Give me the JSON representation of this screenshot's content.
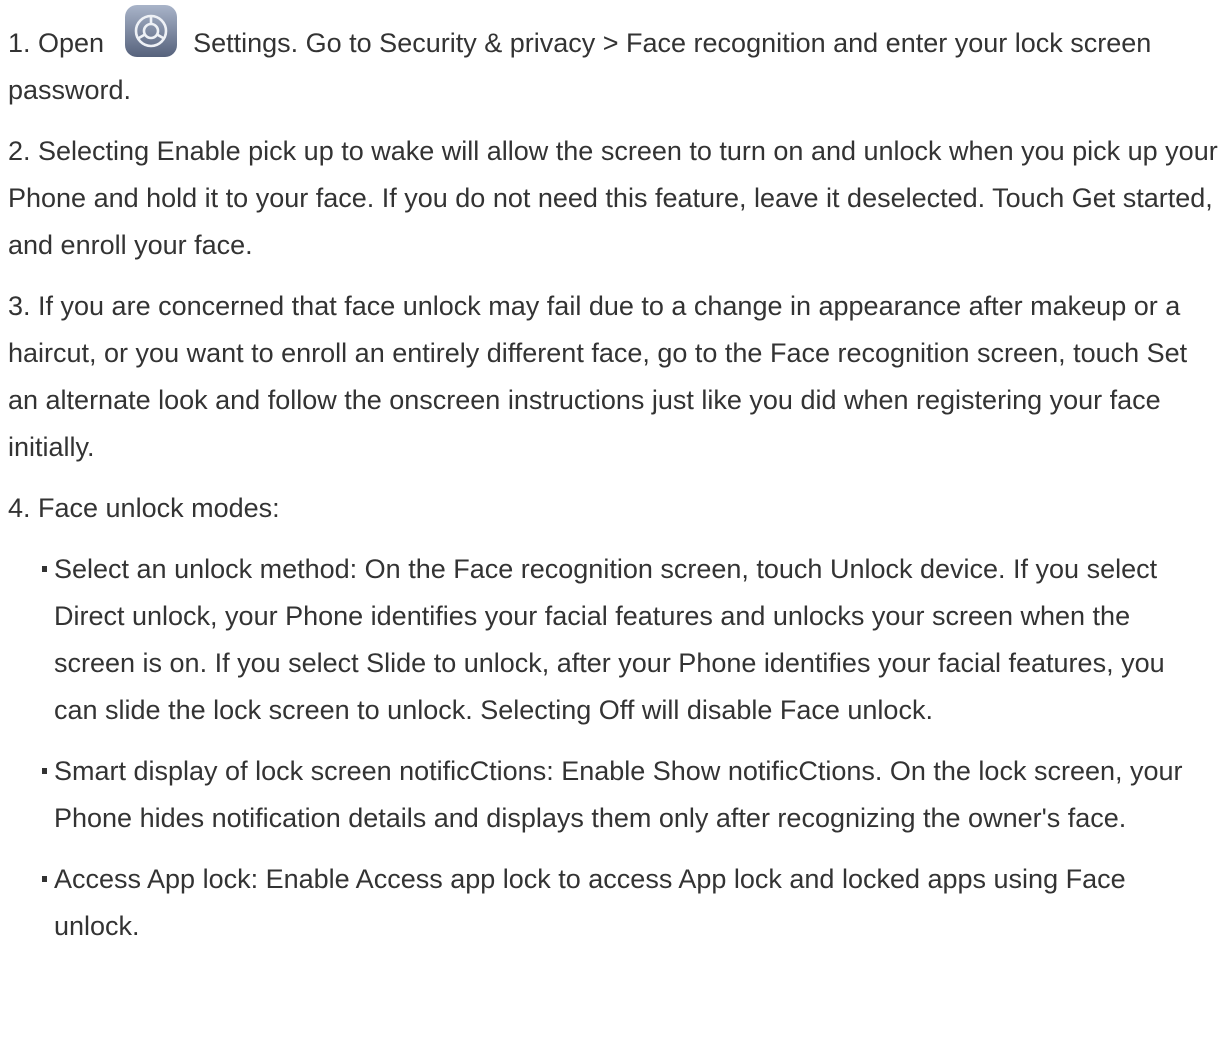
{
  "steps": [
    {
      "prefix": "1. Open ",
      "icon": "settings-gear-icon",
      "suffix": " Settings. Go to Security & privacy > Face recognition and enter your lock screen password."
    },
    {
      "text": "2. Selecting Enable pick up to wake will allow the screen to turn on and unlock when you pick up your Phone and hold it to your face. If you do not need this feature, leave it deselected. Touch Get started, and enroll your face."
    },
    {
      "text": "3. If you are concerned that face unlock may fail due to a change in appearance after makeup or a haircut, or you want to enroll an entirely different face, go to the Face recognition screen, touch Set an alternate look and follow the onscreen instructions just like you did when registering your face initially."
    },
    {
      "text": "4. Face unlock modes:"
    }
  ],
  "modes": [
    "Select an unlock method: On the Face recognition screen, touch Unlock device. If you select Direct unlock, your Phone identifies your facial features and unlocks your screen when the screen is on. If you select Slide to unlock, after your Phone identifies your facial features, you can slide the lock screen to unlock. Selecting Off will disable Face unlock.",
    "Smart display of lock screen notificCtions: Enable Show notificCtions. On the lock screen, your Phone hides notification details and displays them only after recognizing the owner's face.",
    "Access App lock: Enable Access app lock to access App lock and locked apps using Face unlock."
  ],
  "colors": {
    "text": "#333333",
    "icon_bg_top": "#9aa6bd",
    "icon_bg_bottom": "#5e6b85"
  }
}
